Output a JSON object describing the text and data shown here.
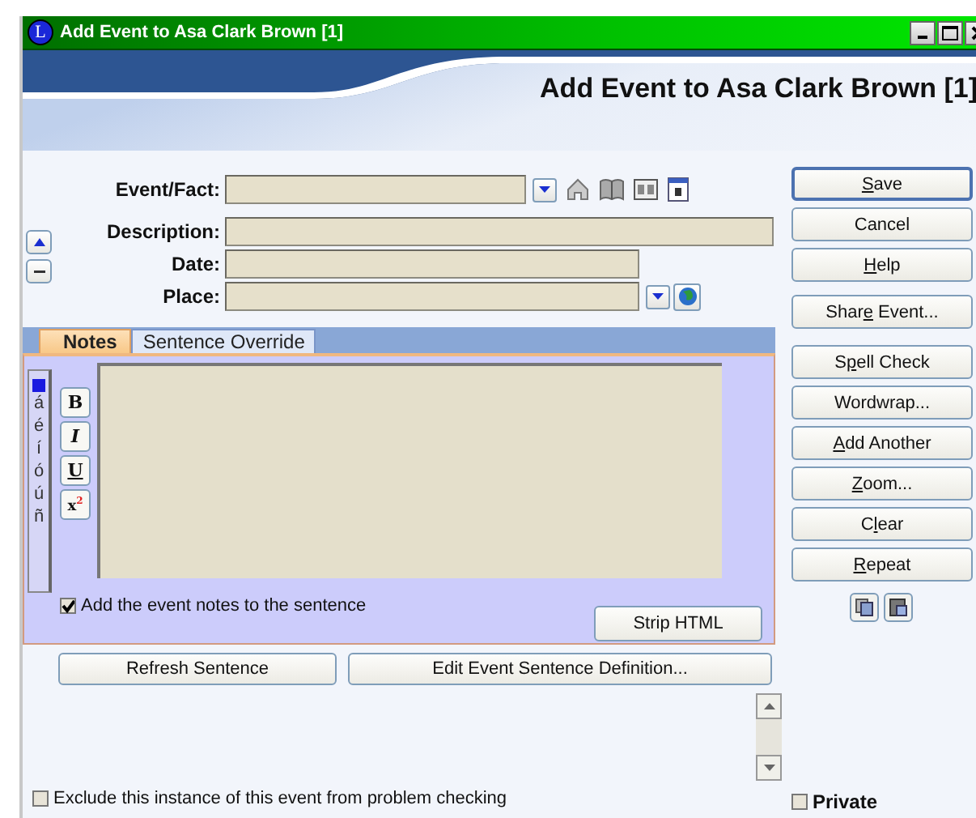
{
  "window": {
    "title": "Add Event to Asa Clark Brown [1]",
    "icon_letter": "L"
  },
  "header": {
    "title": "Add Event to Asa Clark Brown [1]"
  },
  "fields": [
    {
      "kind": "combo",
      "label": "Event/Fact:"
    },
    {
      "kind": "wide",
      "label": "Description:"
    },
    {
      "kind": "plain",
      "label": "Date:"
    },
    {
      "kind": "place",
      "label": "Place:"
    }
  ],
  "tabs": [
    {
      "label": "Notes",
      "selected": true
    },
    {
      "label": "Sentence Override",
      "selected": false
    }
  ],
  "accent_chars": [
    "á",
    "é",
    "í",
    "ó",
    "ú",
    "ñ"
  ],
  "format_buttons": [
    {
      "kind": "bold",
      "label": "B"
    },
    {
      "kind": "italic",
      "label": "I"
    },
    {
      "kind": "underline",
      "label": "U"
    },
    {
      "kind": "superscript",
      "label": "x$^{2}$"
    }
  ],
  "add_notes_checkbox": {
    "label": "Add the event notes to the sentence",
    "checked": true
  },
  "strip_html_button": "Strip HTML",
  "sentence_buttons": [
    "Refresh Sentence",
    "Edit Event Sentence Definition..."
  ],
  "exclude_checkbox": {
    "label": "Exclude this instance of this event from problem checking",
    "checked": false
  },
  "private_checkbox": {
    "label": "Private",
    "checked": false
  },
  "side_buttons": [
    {
      "key": "S",
      "post": "ave",
      "default": true
    },
    {
      "pre": "Cancel",
      "default": false
    },
    {
      "key": "H",
      "post": "elp",
      "default": false
    },
    {
      "pre": "Shar",
      "key": "e",
      "post": " Event...",
      "default": false
    },
    {
      "pre": "S",
      "key": "p",
      "post": "ell Check",
      "default": false
    },
    {
      "pre": "Wordwrap...",
      "default": false
    },
    {
      "key": "A",
      "post": "dd Another",
      "default": false
    },
    {
      "key": "Z",
      "post": "oom...",
      "default": false
    },
    {
      "pre": "C",
      "key": "l",
      "post": "ear",
      "default": false
    },
    {
      "key": "R",
      "post": "epeat",
      "default": false
    }
  ]
}
